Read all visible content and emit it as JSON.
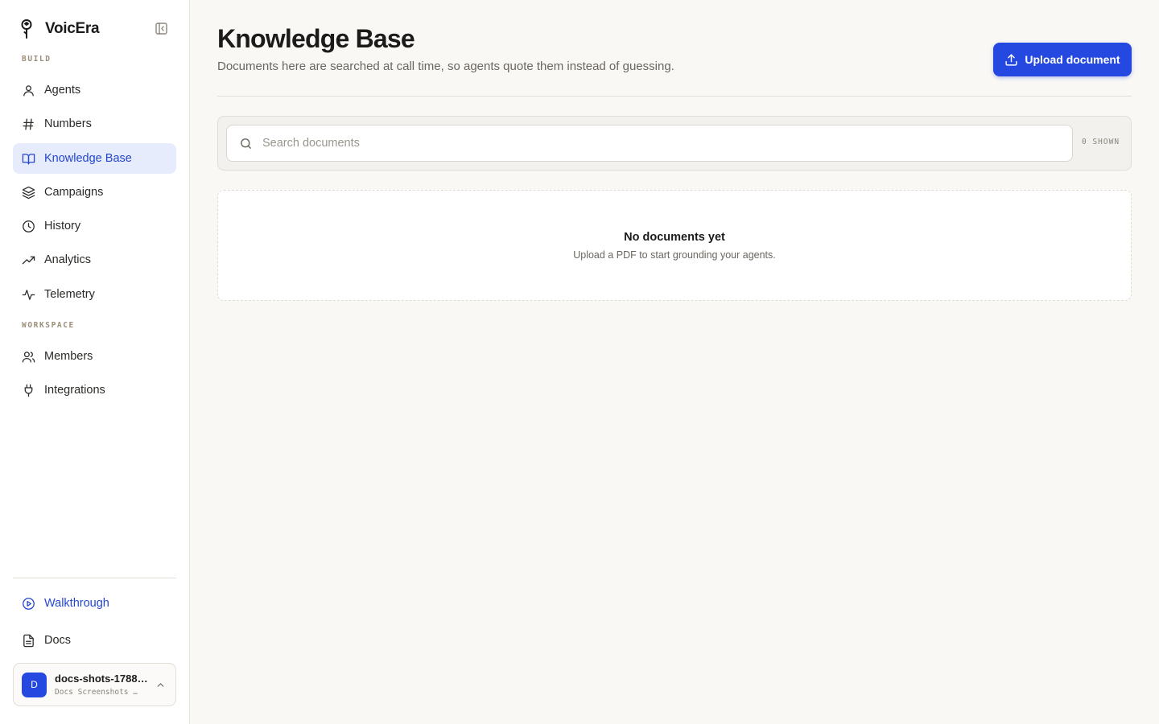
{
  "app": {
    "name": "VoicEra"
  },
  "sidebar": {
    "sections": {
      "build": "BUILD",
      "workspace": "WORKSPACE"
    },
    "build_items": [
      {
        "label": "Agents",
        "icon": "user-icon"
      },
      {
        "label": "Numbers",
        "icon": "hash-icon"
      },
      {
        "label": "Knowledge Base",
        "icon": "book-icon",
        "active": true
      },
      {
        "label": "Campaigns",
        "icon": "layers-icon"
      },
      {
        "label": "History",
        "icon": "clock-icon"
      },
      {
        "label": "Analytics",
        "icon": "trending-up-icon"
      },
      {
        "label": "Telemetry",
        "icon": "activity-icon"
      }
    ],
    "workspace_items": [
      {
        "label": "Members",
        "icon": "users-icon"
      },
      {
        "label": "Integrations",
        "icon": "plug-icon"
      }
    ],
    "footer_items": [
      {
        "label": "Walkthrough",
        "icon": "play-circle-icon"
      },
      {
        "label": "Docs",
        "icon": "file-text-icon"
      }
    ],
    "account": {
      "initial": "D",
      "name": "docs-shots-1788…",
      "subtitle": "Docs Screenshots …"
    }
  },
  "header": {
    "title": "Knowledge Base",
    "subtitle": "Documents here are searched at call time, so agents quote them instead of guessing.",
    "upload_label": "Upload document"
  },
  "search": {
    "placeholder": "Search documents",
    "value": "",
    "shown_label": "0 SHOWN"
  },
  "empty_state": {
    "title": "No documents yet",
    "subtitle": "Upload a PDF to start grounding your agents."
  },
  "colors": {
    "accent": "#2548e0",
    "active_bg": "#e6ecfb",
    "background": "#f9f8f5"
  }
}
